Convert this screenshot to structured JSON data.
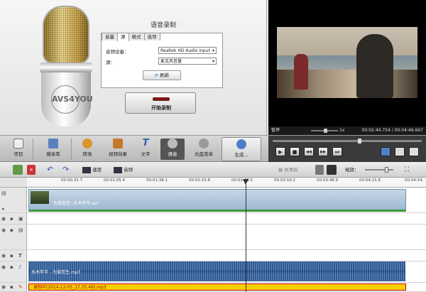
{
  "recorder": {
    "title": "语音录制",
    "tabs": [
      "音量",
      "源",
      "格式",
      "选项"
    ],
    "active_tab": "源",
    "device_label": "音频设备：",
    "device_value": "Realtek HD Audio Input",
    "source_label": "源：",
    "source_value": "麦克风音量",
    "refresh_label": "刷新",
    "start_label": "开始录制",
    "mic_logo": "AVS4YOU"
  },
  "player": {
    "status": "暂停",
    "speed": "1x",
    "time": "00:02:44.754 / 00:04:46.667"
  },
  "toolbar": {
    "items": [
      "项目",
      "媒体库",
      "转场",
      "视频效果",
      "文字",
      "语音",
      "光盘菜单",
      "生成..."
    ],
    "active": "语音"
  },
  "player_controls": [
    "▶",
    "■",
    "◀◀",
    "▶▶",
    "⏭"
  ],
  "timeline": {
    "speed_label": "速度",
    "audio_label": "音频",
    "storyboard_label": "故事板",
    "zoom_label": "缩放：",
    "ruler": [
      "00:00:32.7",
      "00:01:05.4",
      "00:01:38.1",
      "00:02:10.8",
      "00:02:43.5",
      "00:03:16.2",
      "00:03:48.9",
      "00:04:21.6",
      "00:04:54."
    ],
    "video_clip": "为爱而生--水木年华.avi",
    "audio_clip": "水木年华 - 为爱而生.mp3",
    "rec_clip": "录制中(2014-12-05_17.25.46).mp3"
  }
}
